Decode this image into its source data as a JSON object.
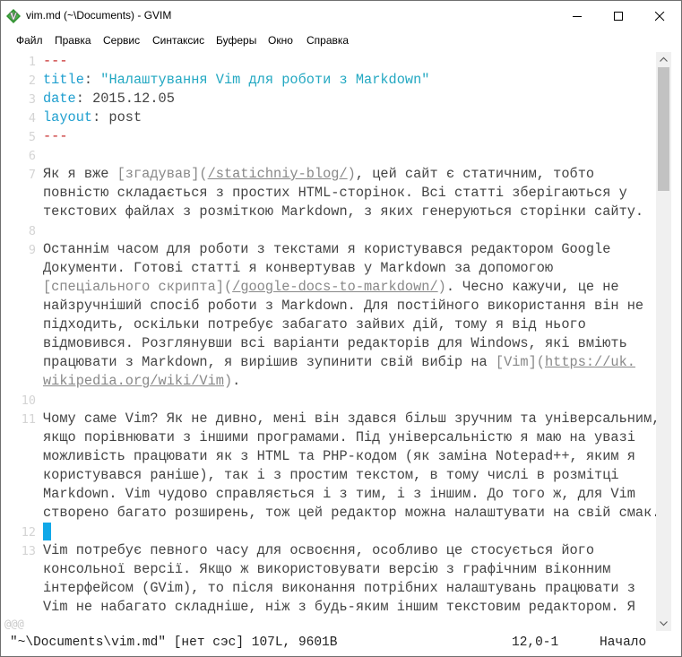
{
  "window": {
    "title": "vim.md (~\\Documents) - GVIM",
    "icon": "vim-icon",
    "controls": [
      "minimize-icon",
      "maximize-icon",
      "close-icon"
    ]
  },
  "menu": [
    "Файл",
    "Правка",
    "Сервис",
    "Синтаксис",
    "Буферы",
    "Окно",
    "Справка"
  ],
  "editor": {
    "lines": [
      {
        "n": "1",
        "segs": [
          {
            "t": "---",
            "c": "k-red"
          }
        ]
      },
      {
        "n": "2",
        "segs": [
          {
            "t": "title",
            "c": "k-blue"
          },
          {
            "t": ": ",
            "c": "k-txt"
          },
          {
            "t": "\"Налаштування Vim для роботи з Markdown\"",
            "c": "k-str"
          }
        ]
      },
      {
        "n": "3",
        "segs": [
          {
            "t": "date",
            "c": "k-blue"
          },
          {
            "t": ": 2015.12.05",
            "c": "k-txt"
          }
        ]
      },
      {
        "n": "4",
        "segs": [
          {
            "t": "layout",
            "c": "k-blue"
          },
          {
            "t": ": post",
            "c": "k-txt"
          }
        ]
      },
      {
        "n": "5",
        "segs": [
          {
            "t": "---",
            "c": "k-red"
          }
        ]
      },
      {
        "n": "6",
        "segs": []
      },
      {
        "n": "7",
        "segs": [
          {
            "t": "Як я вже ",
            "c": "k-txt"
          },
          {
            "t": "[згадував]",
            "c": "k-link"
          },
          {
            "t": "(",
            "c": "k-link"
          },
          {
            "t": "/statichniy-blog/",
            "c": "k-url"
          },
          {
            "t": ")",
            "c": "k-link"
          },
          {
            "t": ", цей сайт є статичним, тобто",
            "c": "k-txt"
          }
        ]
      },
      {
        "n": "",
        "segs": [
          {
            "t": "повністю складається з простих HTML-сторінок. Всі статті зберігаються у",
            "c": "k-txt"
          }
        ]
      },
      {
        "n": "",
        "segs": [
          {
            "t": "текстових файлах з розміткою Markdown, з яких генеруються сторінки сайту.",
            "c": "k-txt"
          }
        ]
      },
      {
        "n": "8",
        "segs": []
      },
      {
        "n": "9",
        "segs": [
          {
            "t": "Останнім часом для роботи з текстами я користувався редактором Google",
            "c": "k-txt"
          }
        ]
      },
      {
        "n": "",
        "segs": [
          {
            "t": "Документи. Готові статті я конвертував у Markdown за допомогою",
            "c": "k-txt"
          }
        ]
      },
      {
        "n": "",
        "segs": [
          {
            "t": "[спеціального скрипта]",
            "c": "k-link"
          },
          {
            "t": "(",
            "c": "k-link"
          },
          {
            "t": "/google-docs-to-markdown/",
            "c": "k-url"
          },
          {
            "t": ")",
            "c": "k-link"
          },
          {
            "t": ". Чесно кажучи, це не",
            "c": "k-txt"
          }
        ]
      },
      {
        "n": "",
        "segs": [
          {
            "t": "найзручніший спосіб роботи з Markdown. Для постійного використання він не",
            "c": "k-txt"
          }
        ]
      },
      {
        "n": "",
        "segs": [
          {
            "t": "підходить, оскільки потребує забагато зайвих дій, тому я від нього",
            "c": "k-txt"
          }
        ]
      },
      {
        "n": "",
        "segs": [
          {
            "t": "відмовився. Розглянувши всі варіанти редакторів для Windows, які вміють",
            "c": "k-txt"
          }
        ]
      },
      {
        "n": "",
        "segs": [
          {
            "t": "працювати з Markdown, я вирішив зупинити свій вибір на ",
            "c": "k-txt"
          },
          {
            "t": "[Vim]",
            "c": "k-link"
          },
          {
            "t": "(",
            "c": "k-link"
          },
          {
            "t": "https://uk.",
            "c": "k-url"
          }
        ]
      },
      {
        "n": "",
        "segs": [
          {
            "t": "wikipedia.org/wiki/Vim",
            "c": "k-url"
          },
          {
            "t": ")",
            "c": "k-link"
          },
          {
            "t": ".",
            "c": "k-txt"
          }
        ]
      },
      {
        "n": "10",
        "segs": []
      },
      {
        "n": "11",
        "segs": [
          {
            "t": "Чому саме Vim? Як не дивно, мені він здався більш зручним та універсальним,",
            "c": "k-txt"
          }
        ]
      },
      {
        "n": "",
        "segs": [
          {
            "t": "якщо порівнювати з іншими програмами. Під універсальністю я маю на увазі",
            "c": "k-txt"
          }
        ]
      },
      {
        "n": "",
        "segs": [
          {
            "t": "можливість працювати як з HTML та PHP-кодом (як заміна Notepad++, яким я",
            "c": "k-txt"
          }
        ]
      },
      {
        "n": "",
        "segs": [
          {
            "t": "користувався раніше), так і з простим текстом, в тому числі в розмітці",
            "c": "k-txt"
          }
        ]
      },
      {
        "n": "",
        "segs": [
          {
            "t": "Markdown. Vim чудово справляється і з тим, і з іншим. До того ж, для Vim",
            "c": "k-txt"
          }
        ]
      },
      {
        "n": "",
        "segs": [
          {
            "t": "створено багато розширень, тож цей редактор можна налаштувати на свій смак.",
            "c": "k-txt"
          }
        ]
      },
      {
        "n": "12",
        "segs": [],
        "cursor": true
      },
      {
        "n": "13",
        "segs": [
          {
            "t": "Vim потребує певного часу для освоєння, особливо це стосується його",
            "c": "k-txt"
          }
        ]
      },
      {
        "n": "",
        "segs": [
          {
            "t": "консольної версії. Якщо ж використовувати версію з графічним віконним",
            "c": "k-txt"
          }
        ]
      },
      {
        "n": "",
        "segs": [
          {
            "t": "інтерфейсом (GVim), то після виконання потрібних налаштувань працювати з",
            "c": "k-txt"
          }
        ]
      },
      {
        "n": "",
        "segs": [
          {
            "t": "Vim не набагато складніше, ніж з будь-яким іншим текстовим редактором. Я",
            "c": "k-txt"
          }
        ]
      }
    ],
    "overflow_marker": "@@@"
  },
  "status": {
    "file": "\"~\\Documents\\vim.md\" [нет сэс] 107L, 9601B",
    "position": "12,0-1",
    "scroll": "Начало"
  }
}
